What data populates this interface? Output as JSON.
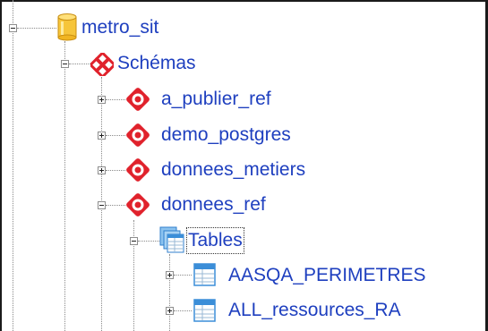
{
  "tree": {
    "root": {
      "label": "metro_sit",
      "icon": "database-icon",
      "expanded": true
    },
    "schemas": {
      "label": "Schémas",
      "icon": "schemas-icon",
      "expanded": true
    },
    "schema_items": [
      {
        "label": "a_publier_ref",
        "icon": "schema-icon",
        "expanded": false
      },
      {
        "label": "demo_postgres",
        "icon": "schema-icon",
        "expanded": false
      },
      {
        "label": "donnees_metiers",
        "icon": "schema-icon",
        "expanded": false
      },
      {
        "label": "donnees_ref",
        "icon": "schema-icon",
        "expanded": true
      }
    ],
    "tables": {
      "label": "Tables",
      "icon": "tables-icon",
      "expanded": true,
      "focused": true
    },
    "table_items": [
      {
        "label": "AASQA_PERIMETRES",
        "icon": "table-icon",
        "expanded": false
      },
      {
        "label": "ALL_ressources_RA",
        "icon": "table-icon",
        "expanded": false
      }
    ]
  },
  "colors": {
    "label": "#1e3fbf",
    "schema_icon": "#e0222c",
    "database_icon": "#f2c230",
    "table_icon": "#3b8ed8"
  }
}
